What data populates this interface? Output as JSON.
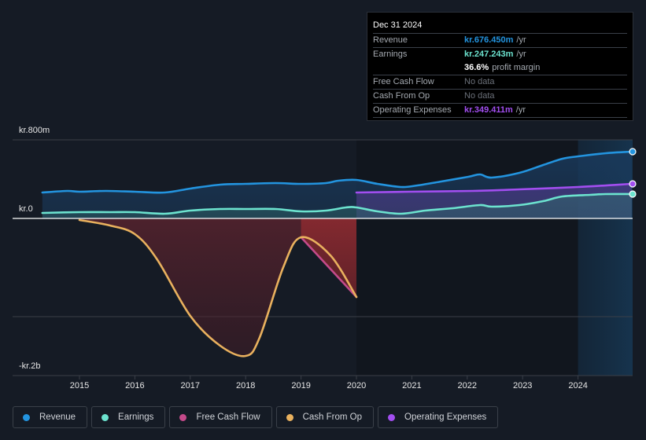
{
  "tooltip": {
    "date": "Dec 31 2024",
    "rows": [
      {
        "label": "Revenue",
        "value": "kr.676.450m",
        "unit": "/yr",
        "color": "#2394df"
      },
      {
        "label": "Earnings",
        "value": "kr.247.243m",
        "unit": "/yr",
        "color": "#6ce3cf"
      },
      {
        "label": "",
        "value": "36.6%",
        "unit": "profit margin",
        "color": "#ffffff"
      },
      {
        "label": "Free Cash Flow",
        "value": "No data",
        "unit": "",
        "color": "#6b7079"
      },
      {
        "label": "Cash From Op",
        "value": "No data",
        "unit": "",
        "color": "#6b7079"
      },
      {
        "label": "Operating Expenses",
        "value": "kr.349.411m",
        "unit": "/yr",
        "color": "#a24ef0"
      }
    ]
  },
  "legend": [
    {
      "label": "Revenue",
      "color": "#2394df"
    },
    {
      "label": "Earnings",
      "color": "#6ce3cf"
    },
    {
      "label": "Free Cash Flow",
      "color": "#c44a8a"
    },
    {
      "label": "Cash From Op",
      "color": "#e9b15e"
    },
    {
      "label": "Operating Expenses",
      "color": "#a24ef0"
    }
  ],
  "chart_data": {
    "type": "area",
    "title": "",
    "xlabel": "",
    "ylabel": "",
    "currency_prefix": "kr.",
    "y_tick_labels": [
      "kr.800m",
      "kr.0",
      "-kr.2b"
    ],
    "x_tick_labels": [
      "2015",
      "2016",
      "2017",
      "2018",
      "2019",
      "2020",
      "2021",
      "2022",
      "2023",
      "2024"
    ],
    "xlim": [
      2014.25,
      2025.0
    ],
    "ylim_millions": [
      -1600,
      800
    ],
    "gridlines_millions": [
      800,
      0,
      -1000
    ],
    "highlight_from": 2024.0,
    "units": "millions",
    "series": [
      {
        "name": "Revenue",
        "color": "#2394df",
        "x": [
          2014.33,
          2014.78,
          2015.0,
          2015.48,
          2016.0,
          2016.54,
          2017.0,
          2017.54,
          2018.0,
          2018.54,
          2019.0,
          2019.45,
          2019.67,
          2020.0,
          2020.38,
          2020.81,
          2021.1,
          2021.53,
          2022.02,
          2022.23,
          2022.44,
          2022.94,
          2023.37,
          2023.72,
          2024.0,
          2024.5,
          2024.97
        ],
        "values": [
          264,
          280,
          272,
          280,
          272,
          264,
          304,
          344,
          352,
          360,
          352,
          360,
          384,
          392,
          352,
          320,
          336,
          376,
          424,
          448,
          416,
          464,
          544,
          608,
          632,
          664,
          680
        ]
      },
      {
        "name": "Earnings",
        "color": "#6ce3cf",
        "x": [
          2014.33,
          2015.0,
          2015.55,
          2016.0,
          2016.54,
          2017.0,
          2017.54,
          2018.0,
          2018.54,
          2019.0,
          2019.45,
          2019.81,
          2020.0,
          2020.38,
          2020.81,
          2021.24,
          2021.74,
          2022.23,
          2022.44,
          2022.94,
          2023.37,
          2023.72,
          2024.22,
          2024.5,
          2024.97
        ],
        "values": [
          56,
          64,
          64,
          64,
          48,
          80,
          96,
          96,
          96,
          72,
          80,
          112,
          112,
          72,
          48,
          80,
          104,
          136,
          120,
          136,
          176,
          224,
          240,
          248,
          248
        ]
      },
      {
        "name": "Operating Expenses",
        "color": "#a24ef0",
        "x": [
          2020.0,
          2020.95,
          2022.09,
          2022.94,
          2024.0,
          2024.97
        ],
        "values": [
          264,
          272,
          280,
          296,
          320,
          352
        ]
      },
      {
        "name": "Cash From Op",
        "color": "#e9b15e",
        "x": [
          2015.0,
          2015.55,
          2016.0,
          2016.4,
          2017.0,
          2017.54,
          2018.0,
          2018.25,
          2018.68,
          2019.0,
          2019.53,
          2020.0
        ],
        "values": [
          -16,
          -72,
          -160,
          -416,
          -992,
          -1296,
          -1400,
          -1216,
          -496,
          -192,
          -376,
          -800
        ]
      },
      {
        "name": "Free Cash Flow",
        "color": "#c44a8a",
        "x": [
          2019.0,
          2020.0
        ],
        "values": [
          -192,
          -800
        ]
      }
    ]
  }
}
